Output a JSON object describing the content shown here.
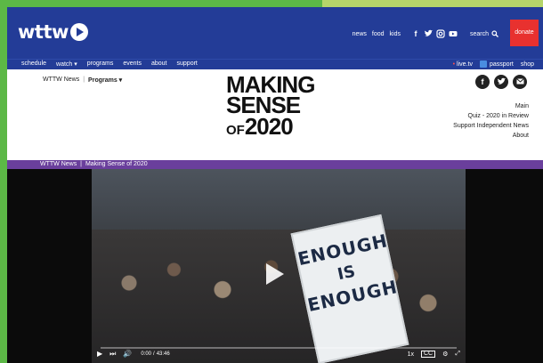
{
  "header": {
    "logo_text": "wttw",
    "top_links": [
      "news",
      "food",
      "kids"
    ],
    "search_label": "search",
    "donate_label": "donate"
  },
  "subnav": {
    "items": [
      "schedule",
      "watch ▾",
      "programs",
      "events",
      "about",
      "support"
    ],
    "live_label": "live.tv",
    "passport_label": "passport",
    "shop_label": "shop"
  },
  "program": {
    "crumb_news": "WTTW News",
    "crumb_sep": "|",
    "crumb_programs": "Programs ▾",
    "title_line1": "MAKING",
    "title_line2": "SENSE",
    "title_of": "OF",
    "title_year": "2020",
    "menu": [
      "Main",
      "Quiz - 2020 in Review",
      "Support Independent News",
      "About"
    ]
  },
  "breadcrumb_bar": {
    "parent": "WTTW News",
    "sep": "|",
    "current": "Making Sense of 2020"
  },
  "video": {
    "sign_line1": "ENOUGH",
    "sign_line2": "IS",
    "sign_line3": "ENOUGH",
    "time_current": "0:00",
    "time_sep": "/",
    "time_total": "43:46",
    "speed": "1x",
    "captions": "CC"
  },
  "colors": {
    "brand_blue": "#233c97",
    "donate_red": "#e8312f",
    "purple_bar": "#6a3f9c",
    "frame_green": "#5cb846"
  }
}
